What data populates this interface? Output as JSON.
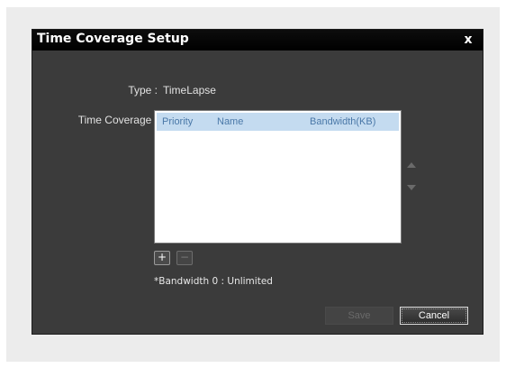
{
  "dialog": {
    "title": "Time Coverage Setup",
    "close_glyph": "x",
    "type_label": "Type :",
    "type_value": "TimeLapse",
    "coverage_label": "Time Coverage :",
    "table": {
      "columns": [
        "Priority",
        "Name",
        "Bandwidth(KB)"
      ],
      "rows": []
    },
    "add_glyph": "+",
    "remove_glyph": "−",
    "note": "*Bandwidth 0 : Unlimited",
    "save_label": "Save",
    "cancel_label": "Cancel"
  },
  "icons": {
    "close": "close-icon",
    "move_up": "move-up-icon",
    "move_down": "move-down-icon"
  },
  "colors": {
    "dialog_bg": "#3b3b3b",
    "titlebar_bg": "#000000",
    "header_bg": "#c4dbf0",
    "header_text": "#4a78a8"
  }
}
